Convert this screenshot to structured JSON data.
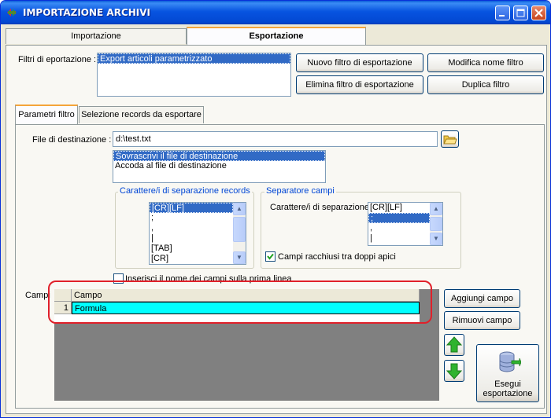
{
  "window": {
    "title": "IMPORTAZIONE ARCHIVI"
  },
  "tabs": [
    {
      "label": "Importazione"
    },
    {
      "label": "Esportazione"
    }
  ],
  "filters": {
    "label": "Filtri di eportazione :",
    "items": [
      "Export articoli parametrizzato"
    ],
    "buttons": {
      "new": "Nuovo filtro di esportazione",
      "rename": "Modifica nome filtro",
      "delete": "Elimina filtro di esportazione",
      "duplicate": "Duplica filtro"
    }
  },
  "subtabs": [
    {
      "label": "Parametri filtro"
    },
    {
      "label": "Selezione records da esportare"
    }
  ],
  "destination": {
    "label": "File di destinazione :",
    "value": "d:\\test.txt",
    "modes": [
      "Sovrascrivi il file di destinazione",
      "Accoda al file di destinazione"
    ]
  },
  "record_separator": {
    "title": "Carattere/i di separazione records",
    "items": [
      "[CR][LF]",
      ";",
      ",",
      "|",
      "[TAB]",
      "[CR]"
    ]
  },
  "field_separator": {
    "title": "Separatore campi",
    "label": "Carattere/i di separazione",
    "items": [
      "[CR][LF]",
      ";",
      ",",
      "|"
    ],
    "quotes_label": "Campi racchiusi tra doppi apici",
    "quotes_checked": true
  },
  "header_option": {
    "label": "Inserisci il nome dei campi sulla prima linea",
    "checked": false
  },
  "fields": {
    "label": "Campi",
    "column_header": "Campo",
    "rows": [
      {
        "index": "1",
        "value": "Formula"
      }
    ],
    "buttons": {
      "add": "Aggiungi campo",
      "remove": "Rimuovi campo",
      "run_line1": "Esegui",
      "run_line2": "esportazione"
    }
  },
  "colors": {
    "title_bar": "#0754e0",
    "selection": "#316ac5",
    "grid_row_highlight": "#00ffff",
    "annotation": "#e0202a",
    "arrow_green": "#2fb32f"
  },
  "icons": [
    "app-icon",
    "minimize-icon",
    "maximize-icon",
    "close-icon",
    "folder-icon",
    "arrow-up-icon",
    "arrow-down-icon",
    "database-export-icon",
    "checkmark-icon"
  ]
}
